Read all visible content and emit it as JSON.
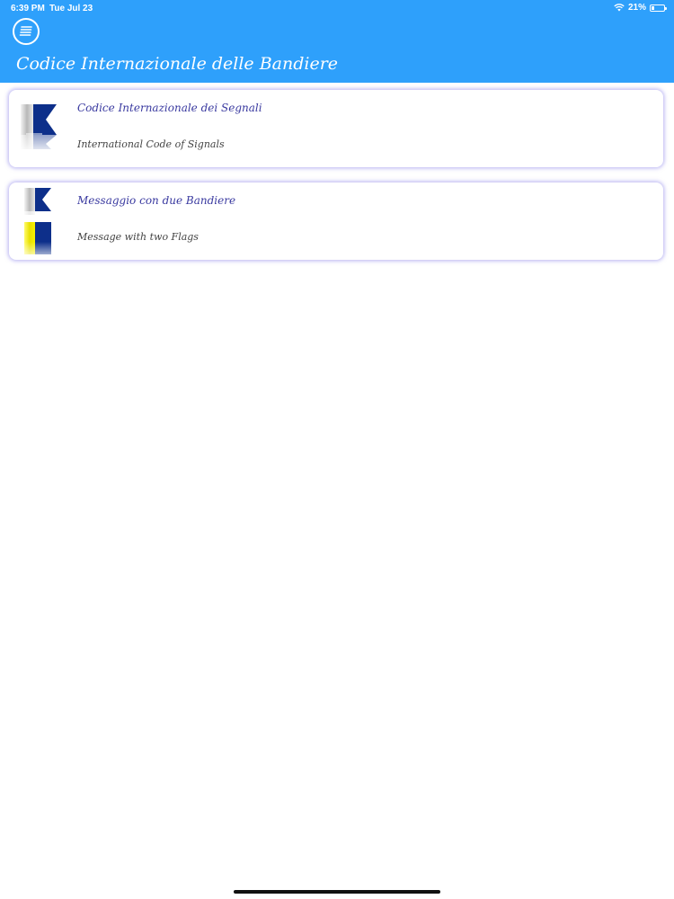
{
  "status_bar": {
    "time": "6:39 PM",
    "date": "Tue Jul 23",
    "battery_percent": "21%",
    "battery_level": 0.21
  },
  "header": {
    "title": "Codice Internazionale delle Bandiere",
    "menu_icon": "menu-icon",
    "background_color": "#2ea0fb"
  },
  "cards": [
    {
      "title": "Codice Internazionale dei Segnali",
      "subtitle": "International Code of Signals",
      "icon": "flag-alpha-icon"
    },
    {
      "title": "Messaggio con due Bandiere",
      "subtitle": "Message with two Flags",
      "icons": [
        "flag-alpha-icon",
        "flag-yellow-blue-icon"
      ]
    }
  ],
  "colors": {
    "accent": "#2ea0fb",
    "card_title": "#3a3aa0",
    "card_shadow": "#786ee6",
    "flag_blue": "#0d2f8a",
    "flag_yellow": "#f2ee00"
  }
}
